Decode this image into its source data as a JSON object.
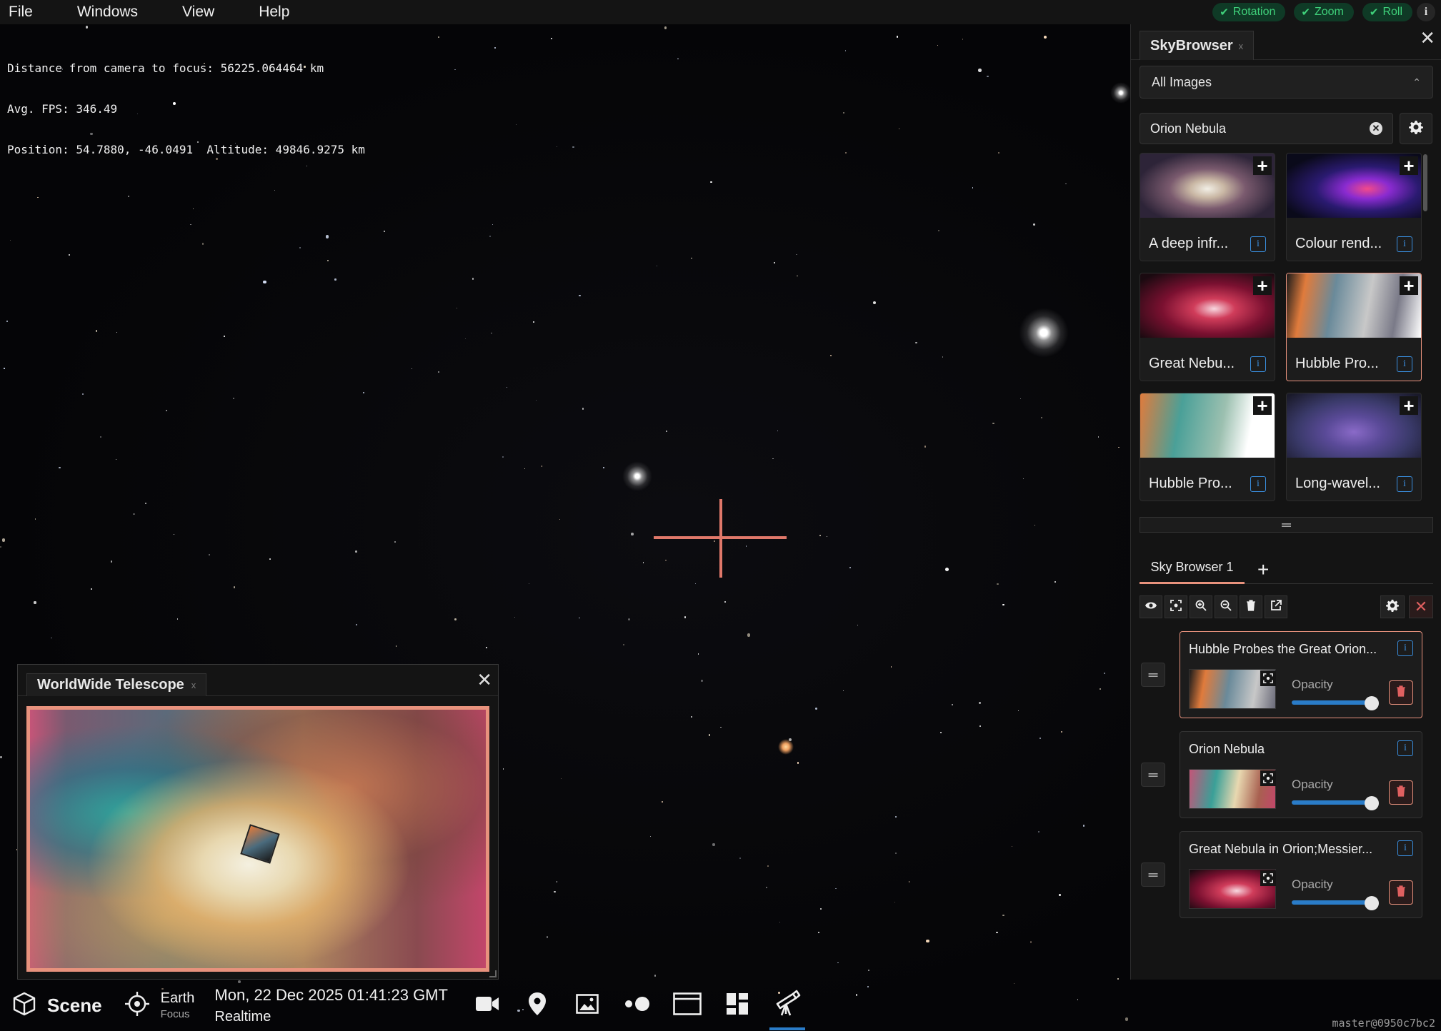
{
  "menubar": {
    "items": [
      "File",
      "Windows",
      "View",
      "Help"
    ],
    "toggles": [
      "Rotation",
      "Zoom",
      "Roll"
    ]
  },
  "debug": {
    "line1": "Distance from camera to focus: 56225.064464 km",
    "line2": "Avg. FPS: 346.49",
    "line3": "Position: 54.7880, -46.0491  Altitude: 49846.9275 km"
  },
  "wwt": {
    "title": "WorldWide Telescope"
  },
  "bottombar": {
    "scene_label": "Scene",
    "focus_name": "Earth",
    "focus_sub": "Focus",
    "date": "Mon, 22 Dec 2025 01:41:23 GMT",
    "time_mode": "Realtime"
  },
  "version": "master@0950c7bc2",
  "skybrowser": {
    "title": "SkyBrowser",
    "filter": "All Images",
    "search_value": "Orion Nebula",
    "cards": [
      {
        "title": "A deep infr...",
        "gradient": "radial-gradient(ellipse at 50% 55%, #f2efe6 0%, #c9b7a4 18%, #7a5a6e 40%, #2d2438 75%)"
      },
      {
        "title": "Colour rend...",
        "gradient": "radial-gradient(ellipse at 60% 55%, #f24a8a 0%, #8a2bd0 20%, #2a1a70 45%, #0a0a1a 80%)"
      },
      {
        "title": "Great Nebu...",
        "gradient": "radial-gradient(ellipse at 55% 55%, #f8d8e0 0%, #d03c5a 20%, #7a1030 50%, #1a0a10 90%)"
      },
      {
        "title": "Hubble Pro...",
        "gradient": "linear-gradient(100deg, #1a1a1a 0%, #e07b3c 14%, #6a8a9a 35%, #c8c8c8 60%, #7a7a88 80%, #ffffff 100%)"
      },
      {
        "title": "Hubble Pro...",
        "gradient": "linear-gradient(100deg, #e07b3c 0%, #4aa098 30%, #9cc0b0 60%, #ffffff 80%, #ffffff 100%)"
      },
      {
        "title": "Long-wavel...",
        "gradient": "radial-gradient(ellipse at 50% 60%, #8a6ac8 0%, #5a4a98 30%, #3a3a6a 60%, #1a1a2a 95%)"
      }
    ],
    "browser_tab": "Sky Browser 1",
    "layers": [
      {
        "title": "Hubble Probes the Great Orion...",
        "opacity_label": "Opacity",
        "opacity": 1.0,
        "gradient": "linear-gradient(100deg, #1a1a1a 0%, #e07b3c 18%, #6a8a9a 45%, #c8c8c8 75%, #6a6a78 100%)"
      },
      {
        "title": "Orion Nebula",
        "opacity_label": "Opacity",
        "opacity": 1.0,
        "gradient": "linear-gradient(100deg, #c45578 0%, #3aa098 30%, #e8d8b0 55%, #a86050 80%, #c2466a 100%)"
      },
      {
        "title": "Great Nebula in Orion;Messier...",
        "opacity_label": "Opacity",
        "opacity": 1.0,
        "gradient": "radial-gradient(ellipse at 55% 55%, #f8d8e0 0%, #d03c5a 25%, #7a1030 60%, #1a0a10 95%)"
      }
    ]
  }
}
